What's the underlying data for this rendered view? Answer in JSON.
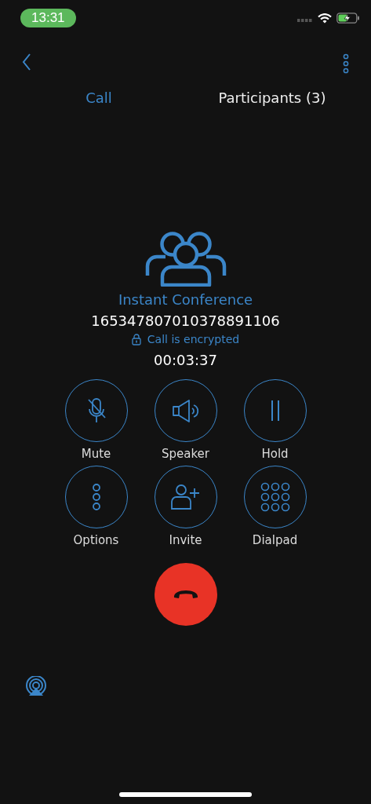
{
  "status_bar": {
    "time": "13:31"
  },
  "tabs": [
    {
      "label": "Call",
      "selected": true
    },
    {
      "label": "Participants (3)",
      "selected": false
    }
  ],
  "call": {
    "name": "Instant Conference",
    "number": "165347807010378891106",
    "encryption": "Call is encrypted",
    "duration": "00:03:37"
  },
  "controls": [
    {
      "kind": "mute",
      "label": "Mute"
    },
    {
      "kind": "speaker",
      "label": "Speaker"
    },
    {
      "kind": "hold",
      "label": "Hold"
    },
    {
      "kind": "options",
      "label": "Options"
    },
    {
      "kind": "invite",
      "label": "Invite"
    },
    {
      "kind": "dialpad",
      "label": "Dialpad"
    }
  ]
}
